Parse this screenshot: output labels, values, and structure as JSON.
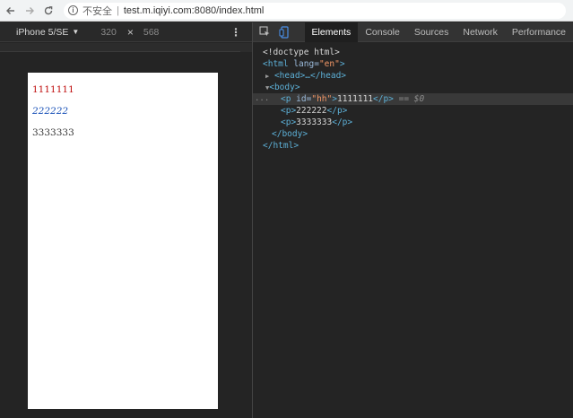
{
  "browser": {
    "insecure_label": "不安全",
    "separator": "|",
    "url": "test.m.iqiyi.com:8080/index.html"
  },
  "device": {
    "name": "iPhone 5/SE",
    "width": "320",
    "times": "×",
    "height": "568",
    "more": "⋮"
  },
  "page": {
    "paragraphs": [
      "1111111",
      "222222",
      "3333333"
    ]
  },
  "devtools": {
    "tabs": [
      "Elements",
      "Console",
      "Sources",
      "Network",
      "Performance"
    ],
    "active_tab": "Elements",
    "dom": {
      "doctype": "<!doctype html>",
      "html_open_tag": "<html",
      "lang_attr": " lang=",
      "lang_val": "\"en\"",
      "close_bracket": ">",
      "head": "<head>…</head>",
      "body_open": "<body>",
      "p_open": "<p",
      "id_attr": " id=",
      "id_val": "\"hh\"",
      "p1_text": "1111111",
      "p_close": "</p>",
      "selected_marker": " == $0",
      "p_open_plain": "<p>",
      "p2_text": "222222",
      "p3_text": "3333333",
      "body_close": "</body>",
      "html_close": "</html>",
      "expand_collapsed": "▶",
      "expand_open": "▼",
      "ellipsis": "..."
    }
  },
  "colors": {
    "p1": "#c01010",
    "p2": "#1a52b8",
    "tag": "#5db0d7",
    "attr_value": "#f29766"
  }
}
